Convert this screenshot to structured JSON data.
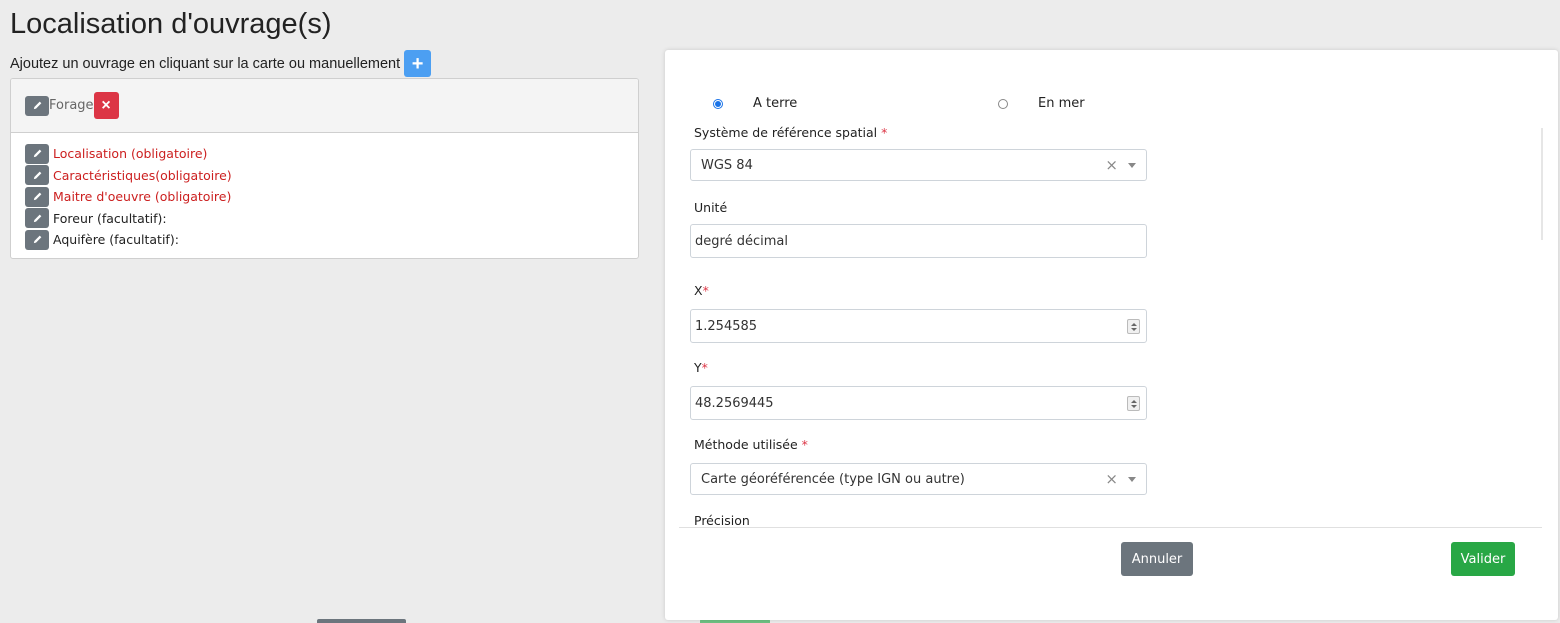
{
  "page": {
    "title": "Localisation d'ouvrage(s)",
    "subtitle": "Ajoutez un ouvrage en cliquant sur la carte ou manuellement",
    "add_symbol": "+"
  },
  "ouvrage": {
    "header_label": "Forage",
    "delete_symbol": "×",
    "items": [
      {
        "label": "Localisation (obligatoire)",
        "required": true
      },
      {
        "label": "Caractéristiques(obligatoire)",
        "required": true
      },
      {
        "label": "Maitre d'oeuvre (obligatoire)",
        "required": true
      },
      {
        "label": "Foreur (facultatif):",
        "required": false
      },
      {
        "label": "Aquifère (facultatif):",
        "required": false
      }
    ]
  },
  "modal": {
    "radio_terre": "A terre",
    "radio_mer": "En mer",
    "systeme_label": "Système de référence spatial",
    "systeme_value": "WGS 84",
    "unite_label": "Unité",
    "unite_value": "degré décimal",
    "x_label": "X",
    "x_value": "1.254585",
    "y_label": "Y",
    "y_value": "48.2569445",
    "methode_label": "Méthode utilisée",
    "methode_value": "Carte géoréférencée (type IGN ou autre)",
    "precision_label": "Précision",
    "required_star": "*",
    "clear_symbol": "×",
    "annuler": "Annuler",
    "valider": "Valider"
  },
  "colors": {
    "required_text": "#cc1f1f",
    "primary": "#4c9ff2",
    "danger": "#dc3545",
    "secondary": "#6c757d",
    "success": "#28a745"
  }
}
